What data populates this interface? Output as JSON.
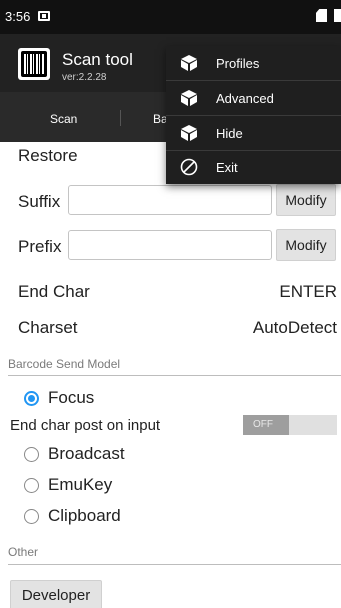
{
  "status_bar": {
    "time": "3:56"
  },
  "app": {
    "title": "Scan tool",
    "version": "ver:2.2.28"
  },
  "tabs": [
    {
      "label": "Scan"
    },
    {
      "label": "Ba"
    }
  ],
  "menu": {
    "items": [
      {
        "label": "Profiles",
        "icon": "cube-icon"
      },
      {
        "label": "Advanced",
        "icon": "cube-icon"
      },
      {
        "label": "Hide",
        "icon": "cube-icon"
      },
      {
        "label": "Exit",
        "icon": "block-icon"
      }
    ]
  },
  "settings": {
    "restore_label": "Restore",
    "suffix": {
      "label": "Suffix",
      "value": "",
      "button": "Modify"
    },
    "prefix": {
      "label": "Prefix",
      "value": "",
      "button": "Modify"
    },
    "end_char": {
      "label": "End Char",
      "value": "ENTER"
    },
    "charset": {
      "label": "Charset",
      "value": "AutoDetect"
    }
  },
  "barcode_send": {
    "header": "Barcode Send Model",
    "options": [
      {
        "label": "Focus",
        "checked": true
      },
      {
        "label": "Broadcast",
        "checked": false
      },
      {
        "label": "EmuKey",
        "checked": false
      },
      {
        "label": "Clipboard",
        "checked": false
      }
    ],
    "end_char_post": {
      "label": "End char post on input",
      "toggle_text": "OFF"
    }
  },
  "other": {
    "header": "Other",
    "developer_button": "Developer"
  },
  "colors": {
    "accent": "#2196f3",
    "app_bar": "#222222",
    "menu_bg": "#1f1f1f"
  }
}
